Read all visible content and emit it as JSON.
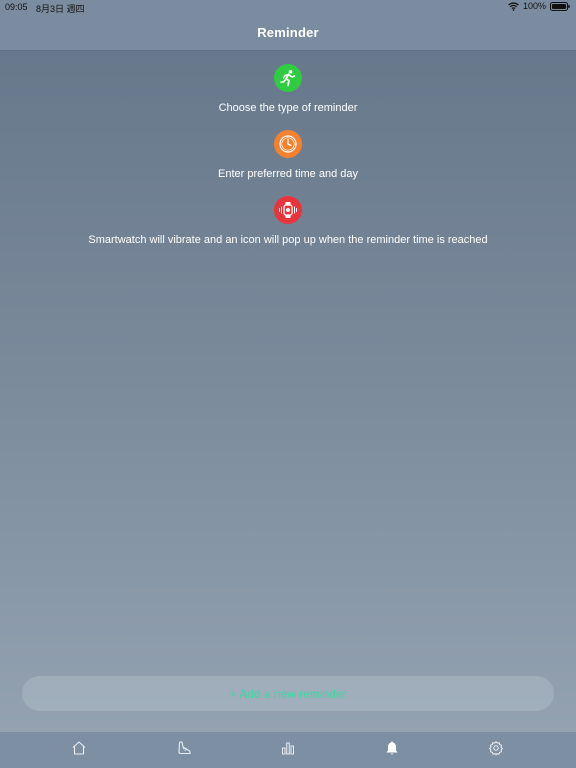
{
  "status_bar": {
    "time": "09:05",
    "date": "8月3日 週四",
    "battery": "100%"
  },
  "nav": {
    "title": "Reminder"
  },
  "steps": [
    {
      "icon": "running-person-icon",
      "color": "#2ecc40",
      "text": "Choose the type of reminder"
    },
    {
      "icon": "clock-icon",
      "color": "#f5802d",
      "text": "Enter preferred time and day"
    },
    {
      "icon": "vibrating-watch-icon",
      "color": "#e8343a",
      "text": "Smartwatch will vibrate and an icon will pop up when the reminder time is reached"
    }
  ],
  "add_button": {
    "label": "+ Add a new reminder",
    "color": "#3fd6a4"
  },
  "tab_bar": {
    "tabs": [
      {
        "icon": "home-icon",
        "selected": false
      },
      {
        "icon": "shoe-icon",
        "selected": false
      },
      {
        "icon": "bar-chart-icon",
        "selected": false
      },
      {
        "icon": "bell-icon",
        "selected": true
      },
      {
        "icon": "gear-icon",
        "selected": false
      }
    ]
  }
}
